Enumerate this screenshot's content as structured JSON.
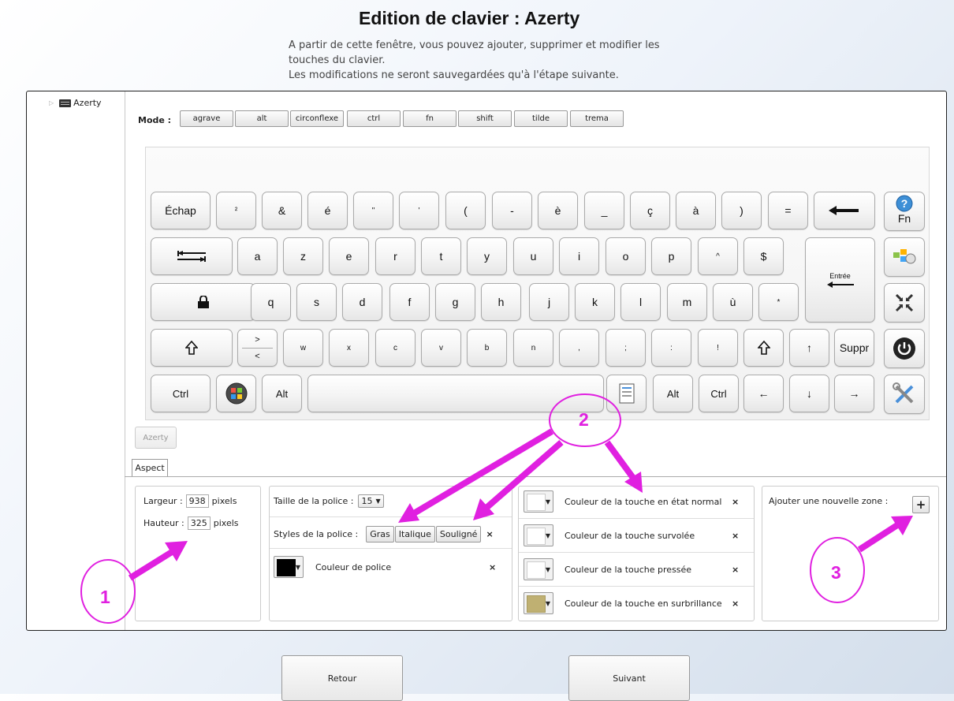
{
  "header": {
    "title": "Edition de clavier : Azerty",
    "description": [
      "A partir de cette fenêtre, vous pouvez ajouter, supprimer et modifier les",
      "touches du clavier.",
      "Les modifications ne seront sauvegardées qu'à l'étape suivante."
    ]
  },
  "tree": {
    "item": "Azerty"
  },
  "mode": {
    "label": "Mode :",
    "buttons": [
      "agrave",
      "alt",
      "circonflexe",
      "ctrl",
      "fn",
      "shift",
      "tilde",
      "trema"
    ]
  },
  "keyboard": {
    "row1": [
      "Échap",
      "²",
      "&",
      "é",
      "\"",
      "'",
      "(",
      "-",
      "è",
      "_",
      "ç",
      "à",
      ")",
      "="
    ],
    "fn_key": "Fn",
    "row2": [
      "a",
      "z",
      "e",
      "r",
      "t",
      "y",
      "u",
      "i",
      "o",
      "p",
      "^",
      "$"
    ],
    "enter_label": "Entrée",
    "row3": [
      "q",
      "s",
      "d",
      "f",
      "g",
      "h",
      "j",
      "k",
      "l",
      "m",
      "ù",
      "*"
    ],
    "angle_key": [
      ">",
      "<"
    ],
    "row4": [
      "w",
      "x",
      "c",
      "v",
      "b",
      "n",
      ",",
      ";",
      ":",
      "!"
    ],
    "up": "↑",
    "suppr": "Suppr",
    "ctrl_left": "Ctrl",
    "alt_left": "Alt",
    "alt_right": "Alt",
    "ctrl_right": "Ctrl",
    "left": "←",
    "down": "↓",
    "right": "→"
  },
  "layout_tab": "Azerty",
  "aspect_tab": "Aspect",
  "size_panel": {
    "width_label": "Largeur :",
    "width_value": "938",
    "height_label": "Hauteur :",
    "height_value": "325",
    "unit": "pixels"
  },
  "font_panel": {
    "size_label": "Taille de la police :",
    "size_value": "15",
    "styles_label": "Styles de la police :",
    "styles": [
      "Gras",
      "Italique",
      "Souligné"
    ],
    "color_label": "Couleur de police",
    "color_value": "#000000",
    "remove": "×"
  },
  "color_panel": {
    "rows": [
      {
        "label": "Couleur de la touche en état normal",
        "color": "#ffffff"
      },
      {
        "label": "Couleur de la touche survolée",
        "color": "#ffffff"
      },
      {
        "label": "Couleur de la touche pressée",
        "color": "#ffffff"
      },
      {
        "label": "Couleur de la touche en surbrillance",
        "color": "#bfb072"
      }
    ],
    "remove": "×"
  },
  "zone_panel": {
    "label": "Ajouter une nouvelle zone :",
    "button": "+"
  },
  "nav": {
    "back": "Retour",
    "next": "Suivant"
  },
  "annotations": {
    "c1": "1",
    "c2": "2",
    "c3": "3",
    "color": "#e020e0"
  }
}
